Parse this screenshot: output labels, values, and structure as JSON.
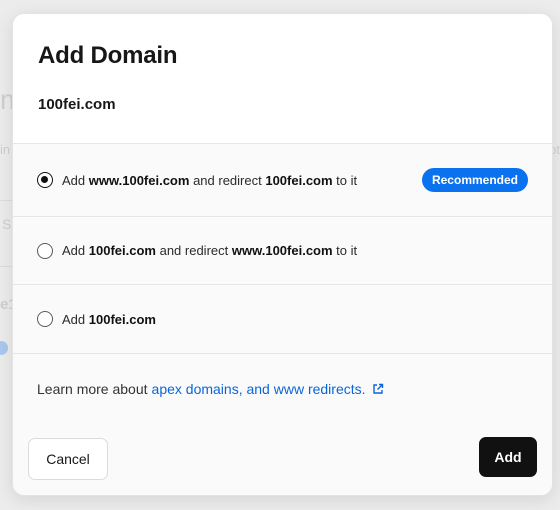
{
  "background": {
    "fragments": [
      "m",
      "in",
      "S",
      "e1",
      "ot"
    ]
  },
  "modal": {
    "title": "Add Domain",
    "domain": "100fei.com",
    "options": [
      {
        "prefix": "Add",
        "primary": "www.100fei.com",
        "middle": "and redirect",
        "secondary": "100fei.com",
        "suffix": "to it",
        "selected": true,
        "badge": "Recommended"
      },
      {
        "prefix": "Add",
        "primary": "100fei.com",
        "middle": "and redirect",
        "secondary": "www.100fei.com",
        "suffix": "to it",
        "selected": false
      },
      {
        "prefix": "Add",
        "primary": "100fei.com",
        "selected": false
      }
    ],
    "learn_more": {
      "text": "Learn more about",
      "link": "apex domains, and www redirects."
    },
    "buttons": {
      "cancel": "Cancel",
      "add": "Add"
    }
  },
  "colors": {
    "accent": "#0a72ef",
    "link": "#0a66d8",
    "primary_button": "#111111"
  },
  "icons": {
    "external_link": "external-link-icon"
  }
}
